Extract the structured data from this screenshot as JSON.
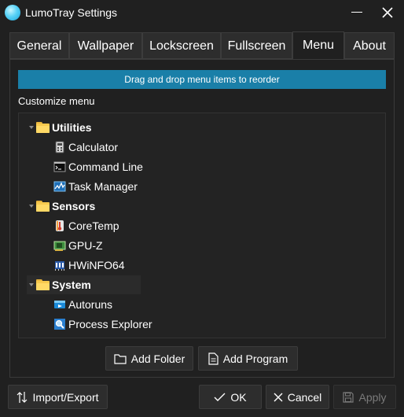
{
  "window": {
    "title": "LumoTray Settings",
    "accent": "#1a7fa8"
  },
  "tabs": [
    {
      "label": "General",
      "active": false
    },
    {
      "label": "Wallpaper",
      "active": false
    },
    {
      "label": "Lockscreen",
      "active": false
    },
    {
      "label": "Fullscreen",
      "active": false
    },
    {
      "label": "Menu",
      "active": true
    },
    {
      "label": "About",
      "active": false
    }
  ],
  "menu_page": {
    "banner": "Drag and drop menu items to reorder",
    "section_label": "Customize menu",
    "tree": [
      {
        "label": "Utilities",
        "icon": "folder-icon",
        "expanded": true,
        "children": [
          {
            "label": "Calculator",
            "icon": "calculator-icon"
          },
          {
            "label": "Command Line",
            "icon": "terminal-icon"
          },
          {
            "label": "Task Manager",
            "icon": "task-manager-icon"
          }
        ]
      },
      {
        "label": "Sensors",
        "icon": "folder-icon",
        "expanded": true,
        "children": [
          {
            "label": "CoreTemp",
            "icon": "thermometer-icon"
          },
          {
            "label": "GPU-Z",
            "icon": "gpu-card-icon"
          },
          {
            "label": "HWiNFO64",
            "icon": "chip-icon"
          }
        ]
      },
      {
        "label": "System",
        "icon": "folder-icon",
        "expanded": true,
        "selected": true,
        "children": [
          {
            "label": "Autoruns",
            "icon": "autoruns-icon"
          },
          {
            "label": "Process Explorer",
            "icon": "magnifier-icon"
          }
        ]
      }
    ],
    "add_folder_label": "Add Folder",
    "add_program_label": "Add Program"
  },
  "footer": {
    "import_export_label": "Import/Export",
    "ok_label": "OK",
    "cancel_label": "Cancel",
    "apply_label": "Apply",
    "apply_enabled": false
  }
}
